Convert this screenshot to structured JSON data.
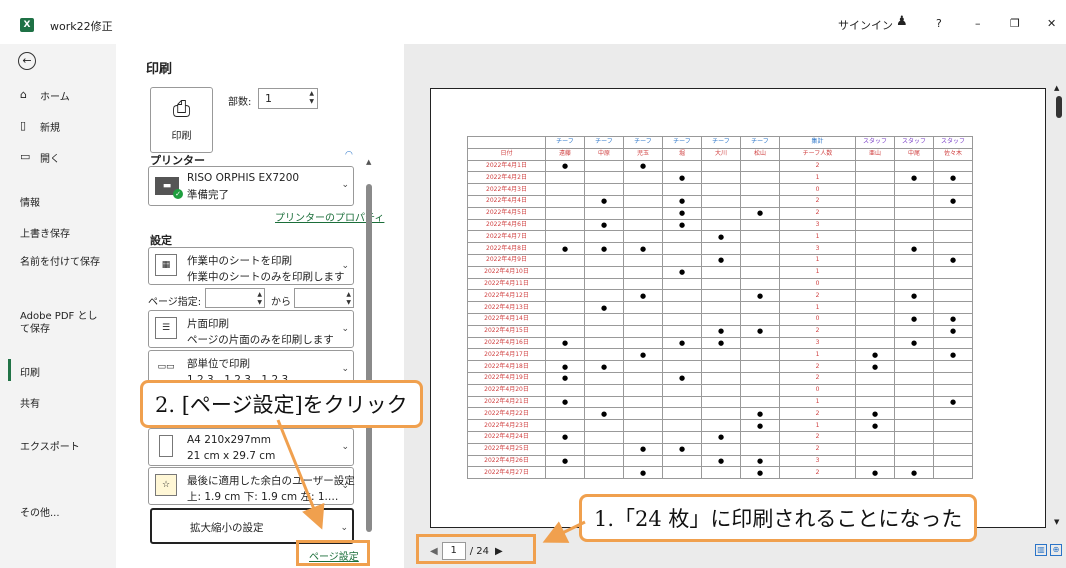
{
  "titlebar": {
    "logo": "X",
    "title": "work22修正",
    "signin": "サインイン",
    "person_icon": "person-icon",
    "help": "?",
    "minimize": "–",
    "restore": "❐",
    "close": "✕"
  },
  "nav": {
    "back": "←",
    "home": "ホーム",
    "new": "新規",
    "open": "開く",
    "info": "情報",
    "save": "上書き保存",
    "saveas": "名前を付けて保存",
    "adobe": "Adobe PDF として保存",
    "print": "印刷",
    "share": "共有",
    "export": "エクスポート",
    "more": "その他..."
  },
  "settings": {
    "title": "印刷",
    "print_button": "印刷",
    "copies_label": "部数:",
    "copies_value": "1",
    "printer_header": "プリンター",
    "printer_name": "RISO ORPHIS EX7200",
    "printer_status": "準備完了",
    "printer_props": "プリンターのプロパティ",
    "settings_header": "設定",
    "sheet_line1": "作業中のシートを印刷",
    "sheet_line2": "作業中のシートのみを印刷します",
    "pages_label": "ページ指定:",
    "pages_to": "から",
    "sides_line1": "片面印刷",
    "sides_line2": "ページの片面のみを印刷します",
    "collate_line1": "部単位で印刷",
    "collate_line2": "1,2,3　1,2,3　1,2,3",
    "paper_line1": "A4 210x297mm",
    "paper_line2": "21 cm x 29.7 cm",
    "margin_line1": "最後に適用した余白のユーザー設定",
    "margin_line2": "上: 1.9 cm 下: 1.9 cm 左: 1.…",
    "scale_line1": "拡大縮小の設定",
    "page_setup": "ページ設定"
  },
  "preview": {
    "current_page": "1",
    "total_pages": "/ 24",
    "headers_row1": [
      "",
      "チーフ",
      "チーフ",
      "チーフ",
      "チーフ",
      "チーフ",
      "チーフ",
      "集計",
      "スタッフ",
      "スタッフ",
      "スタッフ"
    ],
    "headers_row2": [
      "日付",
      "遠藤",
      "中原",
      "児玉",
      "堀",
      "大川",
      "松山",
      "チーフ人数",
      "亜山",
      "中尾",
      "佐々木"
    ],
    "rows": [
      [
        "2022年4月1日",
        "●",
        "",
        "●",
        "",
        "",
        "",
        "2",
        "",
        "",
        ""
      ],
      [
        "2022年4月2日",
        "",
        "",
        "",
        "●",
        "",
        "",
        "1",
        "",
        "●",
        "●"
      ],
      [
        "2022年4月3日",
        "",
        "",
        "",
        "",
        "",
        "",
        "0",
        "",
        "",
        ""
      ],
      [
        "2022年4月4日",
        "",
        "●",
        "",
        "●",
        "",
        "",
        "2",
        "",
        "",
        "●"
      ],
      [
        "2022年4月5日",
        "",
        "",
        "",
        "●",
        "",
        "●",
        "2",
        "",
        "",
        ""
      ],
      [
        "2022年4月6日",
        "",
        "●",
        "",
        "●",
        "",
        "",
        "3",
        "",
        "",
        ""
      ],
      [
        "2022年4月7日",
        "",
        "",
        "",
        "",
        "●",
        "",
        "1",
        "",
        "",
        ""
      ],
      [
        "2022年4月8日",
        "●",
        "●",
        "●",
        "",
        "",
        "",
        "3",
        "",
        "●",
        ""
      ],
      [
        "2022年4月9日",
        "",
        "",
        "",
        "",
        "●",
        "",
        "1",
        "",
        "",
        "●"
      ],
      [
        "2022年4月10日",
        "",
        "",
        "",
        "●",
        "",
        "",
        "1",
        "",
        "",
        ""
      ],
      [
        "2022年4月11日",
        "",
        "",
        "",
        "",
        "",
        "",
        "0",
        "",
        "",
        ""
      ],
      [
        "2022年4月12日",
        "",
        "",
        "●",
        "",
        "",
        "●",
        "2",
        "",
        "●",
        ""
      ],
      [
        "2022年4月13日",
        "",
        "●",
        "",
        "",
        "",
        "",
        "1",
        "",
        "",
        ""
      ],
      [
        "2022年4月14日",
        "",
        "",
        "",
        "",
        "",
        "",
        "0",
        "",
        "●",
        "●"
      ],
      [
        "2022年4月15日",
        "",
        "",
        "",
        "",
        "●",
        "●",
        "2",
        "",
        "",
        "●"
      ],
      [
        "2022年4月16日",
        "●",
        "",
        "",
        "●",
        "●",
        "",
        "3",
        "",
        "●",
        ""
      ],
      [
        "2022年4月17日",
        "",
        "",
        "●",
        "",
        "",
        "",
        "1",
        "●",
        "",
        "●"
      ],
      [
        "2022年4月18日",
        "●",
        "●",
        "",
        "",
        "",
        "",
        "2",
        "●",
        "",
        ""
      ],
      [
        "2022年4月19日",
        "●",
        "",
        "",
        "●",
        "",
        "",
        "2",
        "",
        "",
        ""
      ],
      [
        "2022年4月20日",
        "",
        "",
        "",
        "",
        "",
        "",
        "0",
        "",
        "",
        ""
      ],
      [
        "2022年4月21日",
        "●",
        "",
        "",
        "",
        "",
        "",
        "1",
        "",
        "",
        "●"
      ],
      [
        "2022年4月22日",
        "",
        "●",
        "",
        "",
        "",
        "●",
        "2",
        "●",
        "",
        ""
      ],
      [
        "2022年4月23日",
        "",
        "",
        "",
        "",
        "",
        "●",
        "1",
        "●",
        "",
        ""
      ],
      [
        "2022年4月24日",
        "●",
        "",
        "",
        "",
        "●",
        "",
        "2",
        "",
        "",
        ""
      ],
      [
        "2022年4月25日",
        "",
        "",
        "●",
        "●",
        "",
        "",
        "2",
        "",
        "",
        ""
      ],
      [
        "2022年4月26日",
        "●",
        "",
        "",
        "",
        "●",
        "●",
        "3",
        "",
        "",
        ""
      ],
      [
        "2022年4月27日",
        "",
        "",
        "●",
        "",
        "",
        "●",
        "2",
        "●",
        "●",
        ""
      ]
    ]
  },
  "annotations": {
    "callout1": "1.「24 枚」に印刷されることになった",
    "callout2": "2. [ページ設定]をクリック"
  },
  "colors": {
    "accent": "#217346",
    "callout_border": "#f0a04e"
  }
}
